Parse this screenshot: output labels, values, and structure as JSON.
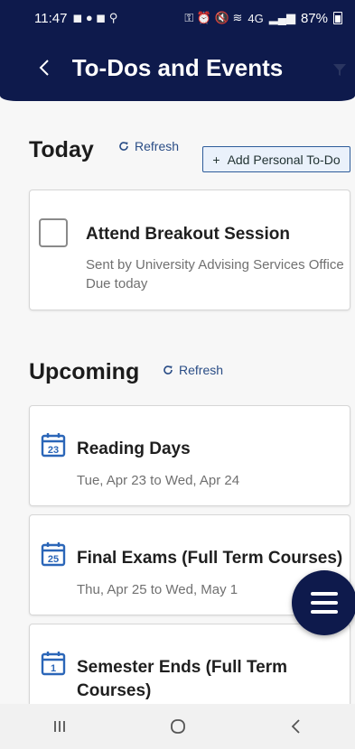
{
  "status_bar": {
    "time": "11:47",
    "battery": "87%",
    "network": "4G"
  },
  "header": {
    "title": "To-Dos and Events"
  },
  "today": {
    "title": "Today",
    "refresh_label": "Refresh",
    "add_label": "Add Personal To-Do",
    "items": [
      {
        "title": "Attend Breakout Session",
        "sent_by": "Sent by University Advising Services Office",
        "due": "Due today"
      }
    ]
  },
  "upcoming": {
    "title": "Upcoming",
    "refresh_label": "Refresh",
    "events": [
      {
        "day_num": "23",
        "title": "Reading Days",
        "dates": "Tue, Apr 23 to Wed, Apr 24"
      },
      {
        "day_num": "25",
        "title": "Final Exams (Full Term Courses)",
        "dates": "Thu, Apr 25 to Wed, May 1"
      },
      {
        "day_num": "1",
        "title_line1": "Semester Ends (Full Term",
        "title_line2": "Courses)"
      }
    ]
  },
  "colors": {
    "primary": "#0e1a4c",
    "link": "#2a4d86",
    "accent": "#2e5c9a"
  },
  "icons": {
    "back": "chevron-left-icon",
    "filter": "filter-icon",
    "refresh": "refresh-icon",
    "calendar": "calendar-icon",
    "menu": "hamburger-menu-icon"
  }
}
